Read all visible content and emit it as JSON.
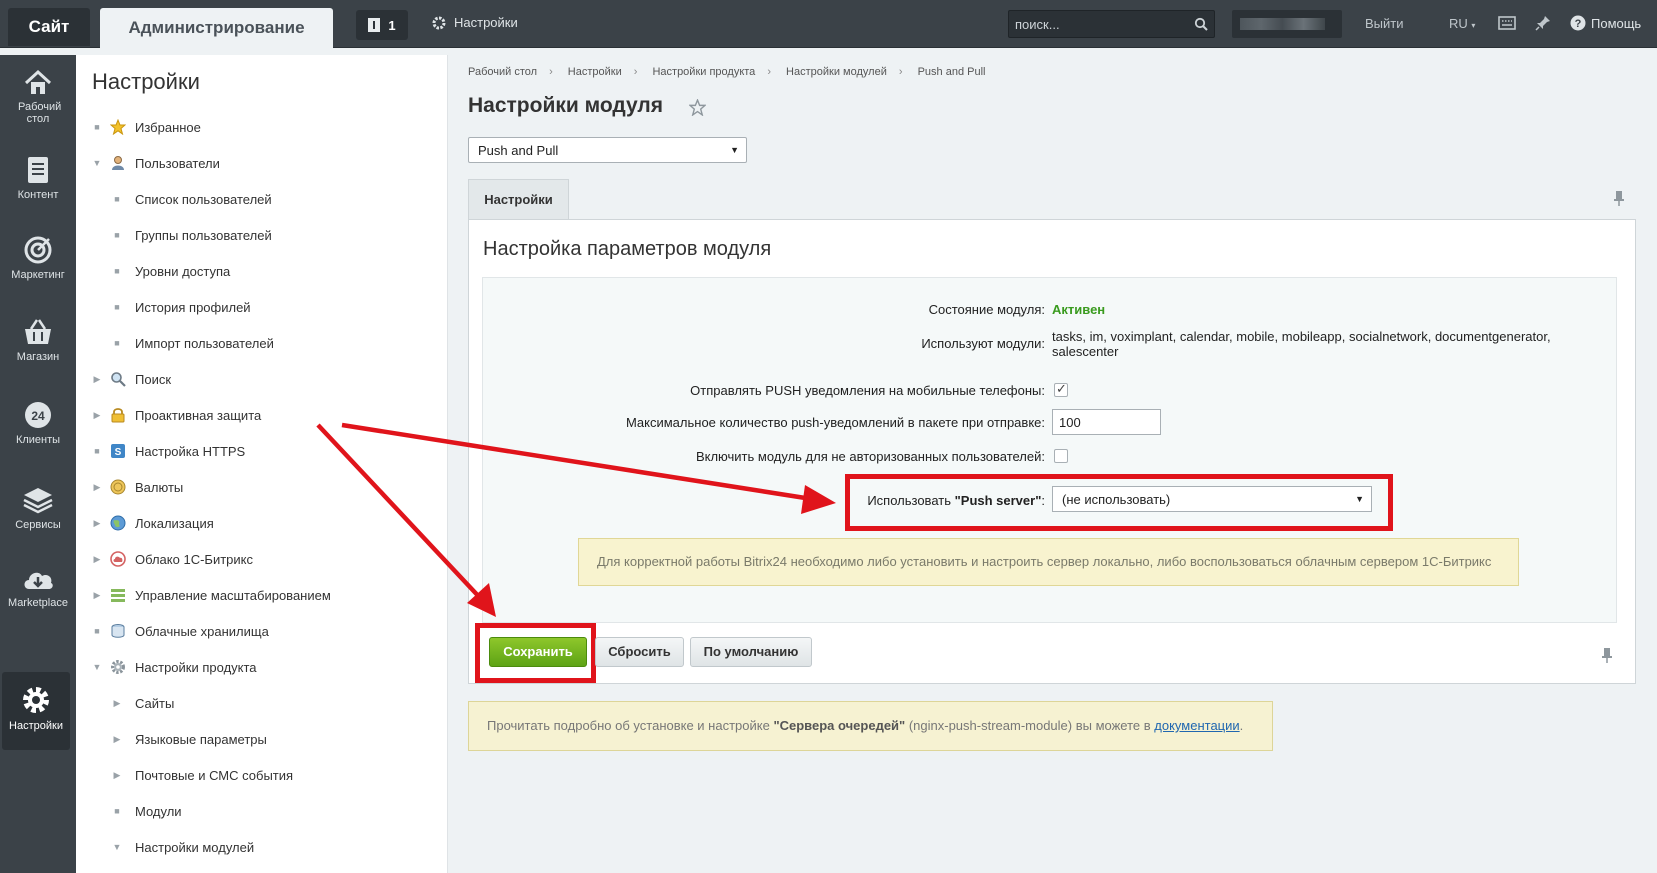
{
  "topbar": {
    "site": "Сайт",
    "admin": "Администрирование",
    "notifications_count": "1",
    "settings_label": "Настройки",
    "search_placeholder": "поиск...",
    "logout": "Выйти",
    "lang": "RU",
    "help": "Помощь"
  },
  "iconbar": {
    "items": [
      {
        "label": "Рабочий стол",
        "icon": "home-icon"
      },
      {
        "label": "Контент",
        "icon": "document-icon"
      },
      {
        "label": "Маркетинг",
        "icon": "target-icon"
      },
      {
        "label": "Магазин",
        "icon": "basket-icon"
      },
      {
        "label": "Клиенты",
        "icon": "clients-24-icon"
      },
      {
        "label": "Сервисы",
        "icon": "layers-icon"
      },
      {
        "label": "Marketplace",
        "icon": "cloud-download-icon"
      },
      {
        "label": "Настройки",
        "icon": "gear-icon"
      }
    ]
  },
  "sidebar": {
    "title": "Настройки",
    "items": [
      {
        "label": "Избранное",
        "icon": "star-icon"
      },
      {
        "label": "Пользователи",
        "icon": "user-icon"
      },
      {
        "label": "Список пользователей"
      },
      {
        "label": "Группы пользователей"
      },
      {
        "label": "Уровни доступа"
      },
      {
        "label": "История профилей"
      },
      {
        "label": "Импорт пользователей"
      },
      {
        "label": "Поиск",
        "icon": "search-icon"
      },
      {
        "label": "Проактивная защита",
        "icon": "lock-icon"
      },
      {
        "label": "Настройка HTTPS",
        "icon": "https-icon"
      },
      {
        "label": "Валюты",
        "icon": "coin-icon"
      },
      {
        "label": "Локализация",
        "icon": "globe-icon"
      },
      {
        "label": "Облако 1С-Битрикс",
        "icon": "cloud-icon"
      },
      {
        "label": "Управление масштабированием",
        "icon": "scale-icon"
      },
      {
        "label": "Облачные хранилища",
        "icon": "storage-icon"
      },
      {
        "label": "Настройки продукта",
        "icon": "gear-icon"
      },
      {
        "label": "Сайты"
      },
      {
        "label": "Языковые параметры"
      },
      {
        "label": "Почтовые и СМС события"
      },
      {
        "label": "Модули"
      },
      {
        "label": "Настройки модулей"
      }
    ]
  },
  "breadcrumb": [
    "Рабочий стол",
    "Настройки",
    "Настройки продукта",
    "Настройки модулей",
    "Push and Pull"
  ],
  "main": {
    "title": "Настройки модуля",
    "module_select": "Push and Pull",
    "tab": "Настройки",
    "panel_title": "Настройка параметров модуля",
    "fields": {
      "state_label": "Состояние модуля:",
      "state_value": "Активен",
      "used_label": "Используют модули:",
      "used_value_line1": "tasks, im, voximplant, calendar, mobile, mobileapp, socialnetwork, documentgenerator,",
      "used_value_line2": "salescenter",
      "push_mobile_label": "Отправлять PUSH уведомления на мобильные телефоны:",
      "push_mobile_checked": true,
      "max_push_label": "Максимальное количество push-уведомлений в пакете при отправке:",
      "max_push_value": "100",
      "guest_label": "Включить модуль для не авторизованных пользователей:",
      "guest_checked": false,
      "push_server_label_prefix": "Использовать ",
      "push_server_label_bold": "\"Push server\"",
      "push_server_label_suffix": ":",
      "push_server_value": "(не использовать)"
    },
    "note": "Для корректной работы Bitrix24 необходимо либо установить и настроить сервер локально, либо воспользоваться облачным сервером 1С-Битрикс",
    "buttons": {
      "save": "Сохранить",
      "reset": "Сбросить",
      "default": "По умолчанию"
    },
    "info": {
      "prefix": "Прочитать подробно об установке и настройке ",
      "bold": "\"Сервера очередей\"",
      "middle": " (nginx-push-stream-module) вы можете в ",
      "link": "документации",
      "suffix": "."
    }
  },
  "colors": {
    "highlight": "#e0141b",
    "save_green": "#6bb31c",
    "active_green": "#3a9b1f"
  }
}
